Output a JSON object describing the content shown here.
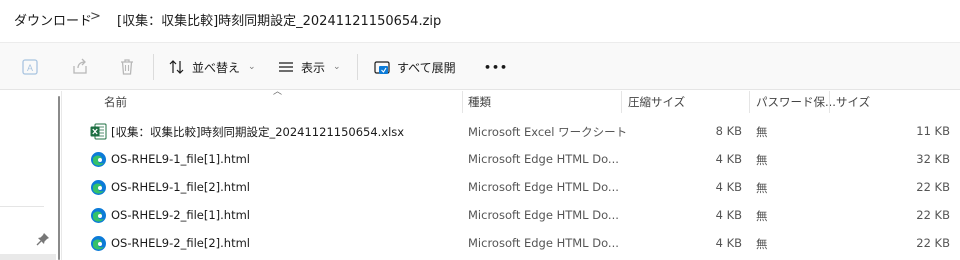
{
  "breadcrumb": {
    "downloads": "ダウンロード",
    "separator": ">",
    "current": "[収集：収集比較]時刻同期設定_20241121150654.zip"
  },
  "toolbar": {
    "sort_label": "並べ替え",
    "view_label": "表示",
    "extract_label": "すべて展開",
    "more_label": "•••",
    "icons": [
      "compress-icon",
      "share-icon",
      "delete-icon",
      "sort-icon",
      "view-icon",
      "extract-all-icon",
      "more-icon"
    ]
  },
  "columns": {
    "name": "名前",
    "type": "種類",
    "compressed_size": "圧縮サイズ",
    "password": "パスワード保...",
    "size": "サイズ"
  },
  "files": [
    {
      "name": "[収集：収集比較]時刻同期設定_20241121150654.xlsx",
      "type": "Microsoft Excel ワークシート",
      "compressed_size": "8 KB",
      "password": "無",
      "size": "11 KB",
      "icon": "excel-icon"
    },
    {
      "name": "OS-RHEL9-1_file[1].html",
      "type": "Microsoft Edge HTML Do...",
      "compressed_size": "4 KB",
      "password": "無",
      "size": "32 KB",
      "icon": "edge-icon"
    },
    {
      "name": "OS-RHEL9-1_file[2].html",
      "type": "Microsoft Edge HTML Do...",
      "compressed_size": "4 KB",
      "password": "無",
      "size": "22 KB",
      "icon": "edge-icon"
    },
    {
      "name": "OS-RHEL9-2_file[1].html",
      "type": "Microsoft Edge HTML Do...",
      "compressed_size": "4 KB",
      "password": "無",
      "size": "22 KB",
      "icon": "edge-icon"
    },
    {
      "name": "OS-RHEL9-2_file[2].html",
      "type": "Microsoft Edge HTML Do...",
      "compressed_size": "4 KB",
      "password": "無",
      "size": "22 KB",
      "icon": "edge-icon"
    }
  ],
  "colors": {
    "excel_green": "#1d6f42",
    "edge_blue": "#0c7bd8",
    "edge_green": "#35c16a"
  }
}
